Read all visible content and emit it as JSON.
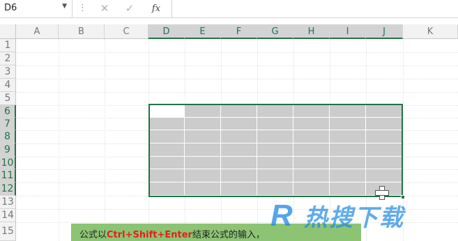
{
  "formula_bar": {
    "name_box": "D6",
    "separator": "⋮",
    "cancel_icon": "✕",
    "enter_icon": "✓",
    "fx_label": "fx",
    "formula": ""
  },
  "columns": [
    "A",
    "B",
    "C",
    "D",
    "E",
    "F",
    "G",
    "H",
    "I",
    "J",
    "K"
  ],
  "selected_columns": [
    "D",
    "E",
    "F",
    "G",
    "H",
    "I",
    "J"
  ],
  "rows": [
    "1",
    "2",
    "3",
    "4",
    "5",
    "6",
    "7",
    "8",
    "9",
    "10",
    "11",
    "12",
    "13",
    "14",
    "15"
  ],
  "selected_rows": [
    "6",
    "7",
    "8",
    "9",
    "10",
    "11",
    "12"
  ],
  "selection": {
    "range": "D6:J12",
    "active_cell": "D6"
  },
  "caption": {
    "prefix": "公式以",
    "keys": "Ctrl+Shift+Enter",
    "suffix": "结束公式的输入，"
  },
  "watermark": {
    "logo_letter": "R",
    "text": "热搜下载"
  },
  "colors": {
    "excel_green": "#217346",
    "selection_fill": "#cccccc",
    "caption_bg": "#8cc474",
    "key_red": "#e02020",
    "watermark_blue": "#1e88e5"
  }
}
